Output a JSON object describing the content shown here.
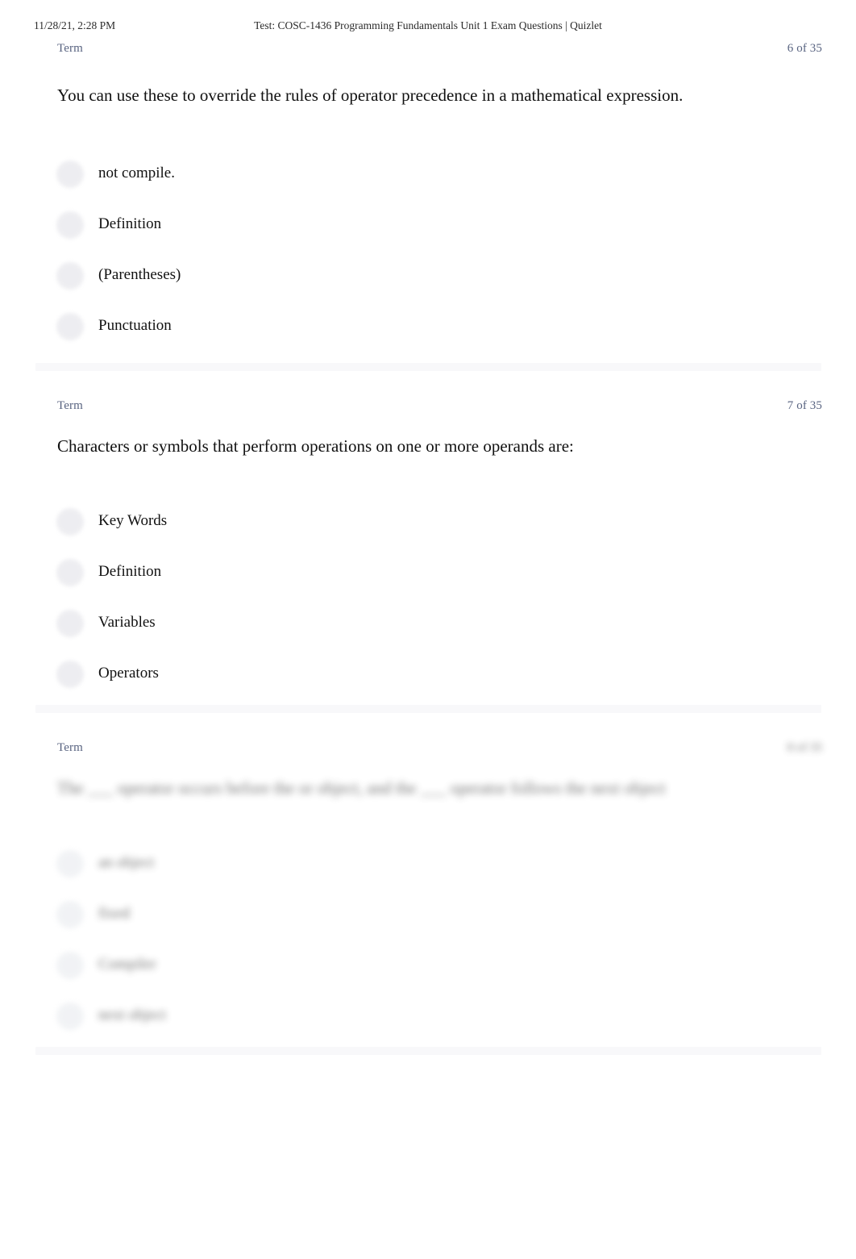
{
  "print_header": {
    "date": "11/28/21, 2:28 PM",
    "title": "Test: COSC-1436 Programming Fundamentals Unit 1 Exam Questions | Quizlet"
  },
  "colors": {
    "meta_text": "#586380",
    "body_text": "#111111",
    "radio_fill": "#ebebef",
    "separator": "#f8f8fa",
    "page_background": "#ffffff"
  },
  "questions": [
    {
      "type_label": "Term",
      "counter": "6 of 35",
      "prompt": "You can use these to override the rules of operator precedence in a mathematical expression.",
      "options": [
        {
          "label": "not compile.",
          "selected": false
        },
        {
          "label": "Definition",
          "selected": false
        },
        {
          "label": "(Parentheses)",
          "selected": false
        },
        {
          "label": "Punctuation",
          "selected": false
        }
      ],
      "obscured": false
    },
    {
      "type_label": "Term",
      "counter": "7 of 35",
      "prompt": "Characters or symbols that perform operations on one or more operands are:",
      "options": [
        {
          "label": "Key Words",
          "selected": false
        },
        {
          "label": "Definition",
          "selected": false
        },
        {
          "label": "Variables",
          "selected": false
        },
        {
          "label": "Operators",
          "selected": false
        }
      ],
      "obscured": false
    },
    {
      "type_label": "Term",
      "counter": "8 of 35",
      "prompt": "The ___ operator occurs before the or object, and the ___ operator follows the next object",
      "options": [
        {
          "label": "an object",
          "selected": false
        },
        {
          "label": "fixed",
          "selected": false
        },
        {
          "label": "Compiler",
          "selected": false
        },
        {
          "label": "next object",
          "selected": false
        }
      ],
      "obscured": true
    }
  ]
}
